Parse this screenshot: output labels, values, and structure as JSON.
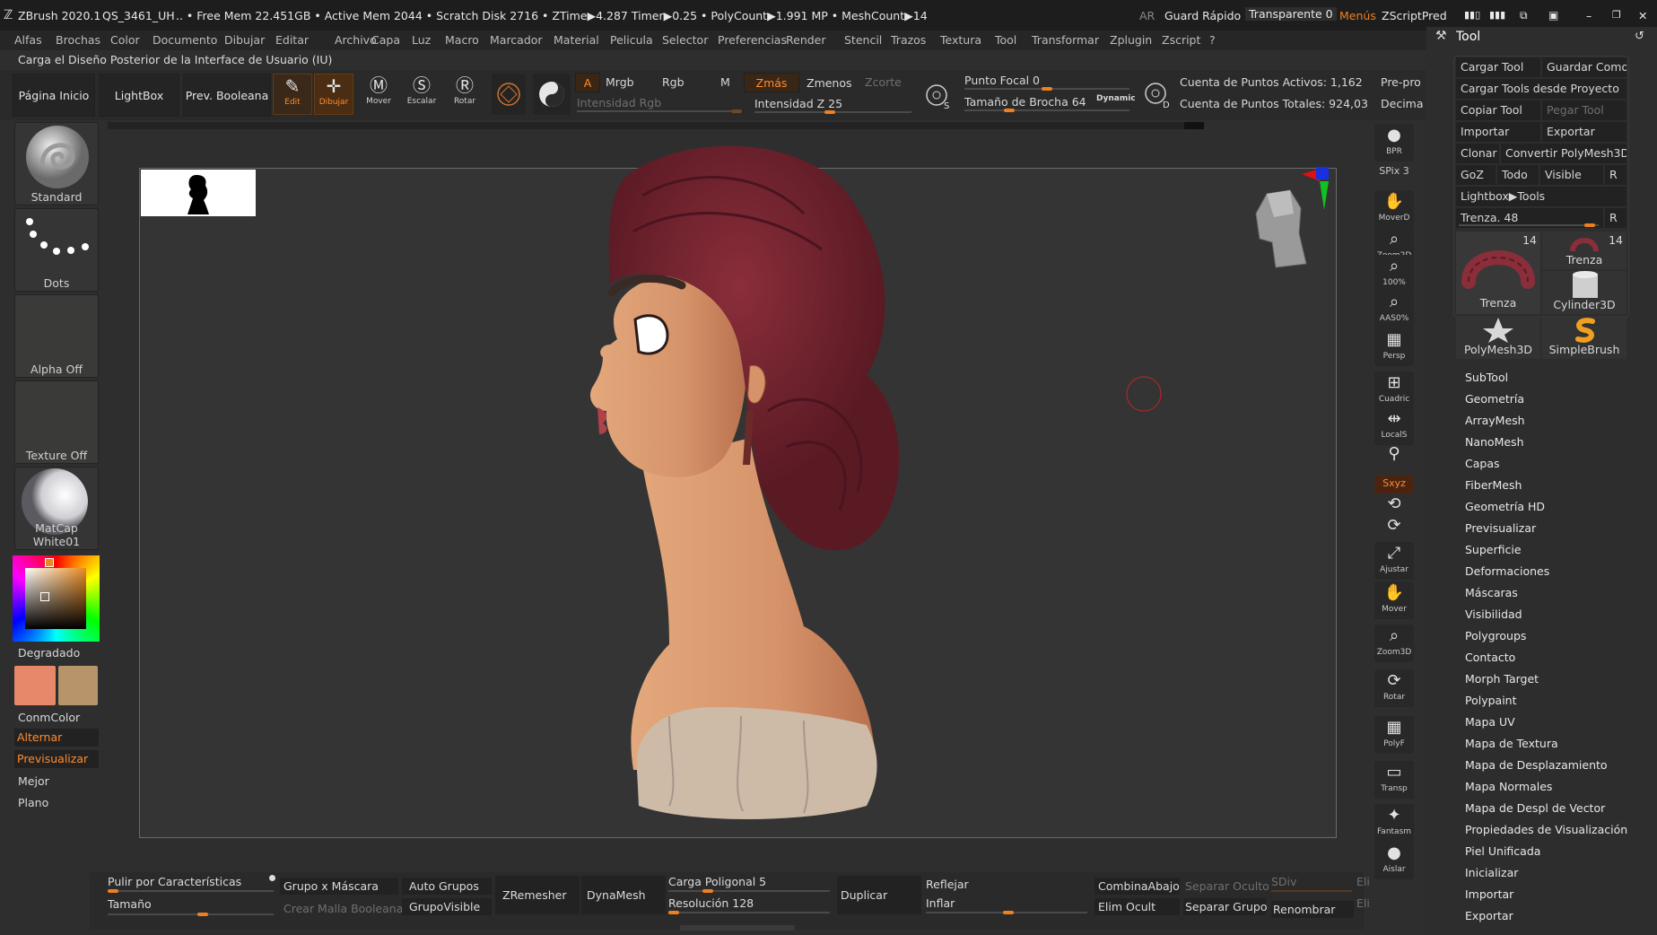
{
  "topbar": {
    "app_title": "ZBrush 2020.1",
    "file_name": "QS_3461_UH",
    "stats": ".. • Free Mem 22.451GB • Active Mem 2044 • Scratch Disk 2716 • ZTime▶4.287 Timer▶0.25 • PolyCount▶1.991 MP • MeshCount▶14",
    "ar": "AR",
    "quick_save": "Guard Rápido",
    "transparent": "Transparente 0",
    "menus": "Menús",
    "zscript": "ZScriptPred"
  },
  "menubar": [
    "Alfas",
    "Brochas",
    "Color",
    "Documento",
    "Dibujar",
    "Editar",
    "Archivo",
    "Capa",
    "Luz",
    "Macro",
    "Marcador",
    "Material",
    "Pelicula",
    "Selector",
    "Preferencias",
    "Render",
    "Stencil",
    "Trazos",
    "Textura",
    "Tool",
    "Transformar",
    "Zplugin",
    "Zscript",
    "?"
  ],
  "hint": "Carga el Diseño Posterior de la Interface de Usuario (IU)",
  "toolbar": {
    "home": "Página Inicio",
    "lightbox": "LightBox",
    "boolean": "Prev. Booleana",
    "edit": "Edit",
    "draw": "Dibujar",
    "move": "Mover",
    "scale": "Escalar",
    "rotate": "Rotar",
    "a": "A",
    "mrgb": "Mrgb",
    "rgb": "Rgb",
    "m": "M",
    "zadd": "Zmás",
    "zsub": "Zmenos",
    "zcut": "Zcorte",
    "rgb_intensity": "Intensidad Rgb",
    "z_intensity": "Intensidad Z 25",
    "focal": "Punto Focal 0",
    "brush_size": "Tamaño de Brocha 64",
    "dynamic": "Dynamic",
    "active_points": "Cuenta de Puntos Activos: 1,162",
    "total_points": "Cuenta de Puntos Totales: 924,03",
    "pre": "Pre-pro",
    "deci": "Decima"
  },
  "left": {
    "brush": "Standard",
    "stroke": "Dots",
    "alpha": "Alpha Off",
    "texture": "Texture Off",
    "material": "MatCap White01",
    "gradient": "Degradado",
    "conmcolor": "ConmColor",
    "alternate": "Alternar",
    "preview": "Previsualizar",
    "better": "Mejor",
    "flat": "Plano"
  },
  "right_tools": [
    "BPR",
    "SPix 3",
    "MoverD",
    "Zoom2D",
    "100%",
    "AAS0%",
    "Persp",
    "Cuadric",
    "LocalS",
    "",
    "Sxyz",
    "",
    "",
    "Ajustar",
    "Mover",
    "Zoom3D",
    "Rotar",
    "PolyF",
    "Transp",
    "Fantasm",
    "Aislar"
  ],
  "toolpanel": {
    "title": "Tool",
    "load_tool": "Cargar Tool",
    "save_as": "Guardar Como",
    "load_project": "Cargar Tools desde Proyecto",
    "copy_tool": "Copiar Tool",
    "paste_tool": "Pegar Tool",
    "import": "Importar",
    "export": "Exportar",
    "clone": "Clonar",
    "convert": "Convertir PolyMesh3D",
    "goz": "GoZ",
    "all": "Todo",
    "visible": "Visible",
    "r": "R",
    "lightbox_tools": "Lightbox▶Tools",
    "trenza_slider": "Trenza. 48",
    "thumbs": [
      "Trenza",
      "Trenza",
      "Cylinder3D",
      "PolyMesh3D",
      "SimpleBrush"
    ],
    "thumb_count": "14",
    "items": [
      "SubTool",
      "Geometría",
      "ArrayMesh",
      "NanoMesh",
      "Capas",
      "FiberMesh",
      "Geometría HD",
      "Previsualizar",
      "Superficie",
      "Deformaciones",
      "Máscaras",
      "Visibilidad",
      "Polygroups",
      "Contacto",
      "Morph Target",
      "Polypaint",
      "Mapa UV",
      "Mapa de Textura",
      "Mapa de Desplazamiento",
      "Mapa Normales",
      "Mapa de Despl de Vector",
      "Propiedades de Visualización",
      "Piel Unificada",
      "Inicializar",
      "Importar",
      "Exportar"
    ]
  },
  "bottom": {
    "polish": "Pulir por Características",
    "size": "Tamaño",
    "group_mask": "Grupo x Máscara",
    "boolean_mesh": "Crear Malla Booleana",
    "auto_groups": "Auto Grupos",
    "group_visible": "GrupoVisible",
    "zremesher": "ZRemesher",
    "dynamesh": "DynaMesh",
    "poly_load": "Carga Poligonal 5",
    "resolution": "Resolución 128",
    "duplicate": "Duplicar",
    "mirror": "Reflejar",
    "inflate": "Inflar",
    "merge_down": "CombinaAbajo",
    "del_hidden": "Elim Ocult",
    "split_hidden": "Separar Oculto",
    "split_group": "Separar Grupo",
    "sdiv": "SDiv",
    "rename": "Renombrar",
    "eli": "Eli"
  },
  "colors": {
    "accent": "#f07f20",
    "primary_swatch": "#e8886a",
    "secondary_swatch": "#b8946a"
  }
}
